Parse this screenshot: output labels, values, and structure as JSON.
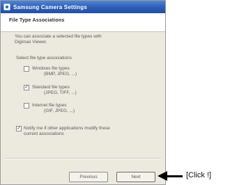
{
  "window": {
    "title": "Samsung Camera Settings"
  },
  "header": {
    "title": "File Type Associations"
  },
  "intro": {
    "line1": "You can associate a selected file types with",
    "line2": "Digimax Viewer."
  },
  "group_label": "Select file type associations",
  "file_types": [
    {
      "label": "Windows file types",
      "extensions": "(BMP, JPEG, ...)",
      "checked": false
    },
    {
      "label": "Standard file types",
      "extensions": "(JPEG, TIFF, ...)",
      "checked": true
    },
    {
      "label": "Internet file types",
      "extensions": "(GIF, JPEG, ...)",
      "checked": false
    }
  ],
  "notify": {
    "checked": true,
    "line1": "Notify me if other applications modify these",
    "line2": "current associations"
  },
  "buttons": {
    "previous": "Previous",
    "next": "Next"
  },
  "annotation": {
    "text": "[Click !]"
  }
}
